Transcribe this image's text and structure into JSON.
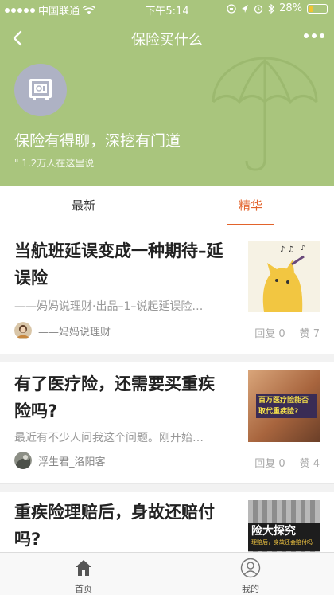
{
  "status_bar": {
    "carrier": "中国联通",
    "time": "下午5:14",
    "battery_percent": "28%",
    "battery_level": 0.28
  },
  "nav": {
    "title": "保险买什么"
  },
  "hero": {
    "title": "保险有得聊，深挖有门道",
    "subtitle": "\" 1.2万人在这里说"
  },
  "tabs": [
    {
      "label": "最新",
      "active": false
    },
    {
      "label": "精华",
      "active": true
    }
  ],
  "articles": [
    {
      "title": "当航班延误变成一种期待–延误险",
      "snippet": "——妈妈说理财·出品–1–说起延误险…",
      "author": "——妈妈说理财",
      "replies": "回复 0",
      "likes": "赞 7"
    },
    {
      "title": "有了医疗险，还需要买重疾险吗?",
      "snippet": "最近有不少人问我这个问题。刚开始…",
      "author": "浮生君_洛阳客",
      "replies": "回复 0",
      "likes": "赞 4",
      "thumb_text": "百万医疗险能否取代重疾险?"
    },
    {
      "title": "重疾险理赔后，身故还赔付吗?",
      "thumb_text": "险大探究",
      "thumb_sub": "理赔后，身故还会赔付吗"
    }
  ],
  "bottom_nav": [
    {
      "label": "首页",
      "icon": "home-icon"
    },
    {
      "label": "我的",
      "icon": "profile-icon"
    }
  ],
  "colors": {
    "hero_bg": "#a9c57d",
    "accent": "#e2632b"
  }
}
